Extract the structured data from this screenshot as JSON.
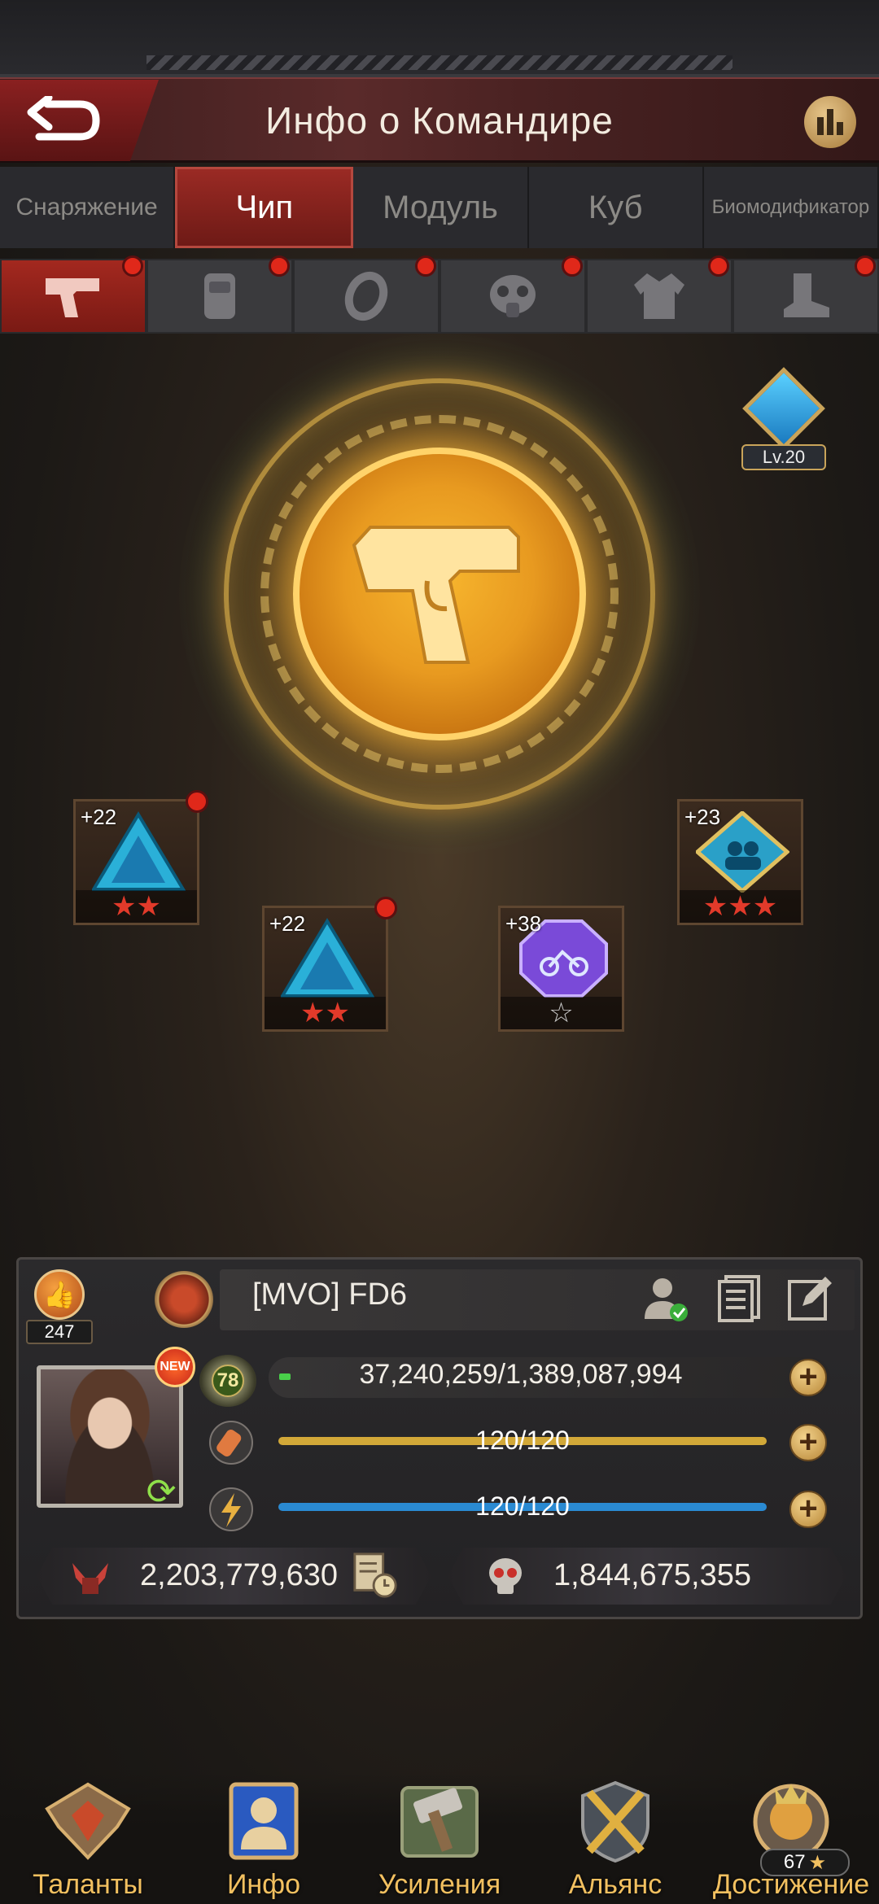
{
  "header": {
    "title": "Инфо о Командире"
  },
  "tabs": [
    {
      "label": "Снаряжение",
      "active": false
    },
    {
      "label": "Чип",
      "active": true
    },
    {
      "label": "Модуль",
      "active": false
    },
    {
      "label": "Куб",
      "active": false
    },
    {
      "label": "Биомодификатор",
      "active": false
    }
  ],
  "slots": [
    {
      "icon": "pistol-icon",
      "active": true,
      "alert": true
    },
    {
      "icon": "vest-icon",
      "active": false,
      "alert": true
    },
    {
      "icon": "ring-icon",
      "active": false,
      "alert": true
    },
    {
      "icon": "gas-mask-icon",
      "active": false,
      "alert": true
    },
    {
      "icon": "jacket-icon",
      "active": false,
      "alert": true
    },
    {
      "icon": "boot-icon",
      "active": false,
      "alert": true
    }
  ],
  "emblem": {
    "icon": "pistol-icon",
    "level_badge": "Lv.20"
  },
  "chips": [
    {
      "level": "+22",
      "stars": 2,
      "star_color": "red",
      "shape": "triangle",
      "alert": true
    },
    {
      "level": "+22",
      "stars": 2,
      "star_color": "red",
      "shape": "triangle",
      "alert": true
    },
    {
      "level": "+38",
      "stars": 1,
      "star_color": "white",
      "shape": "octagon",
      "alert": false
    },
    {
      "level": "+23",
      "stars": 3,
      "star_color": "red",
      "shape": "diamond",
      "alert": false
    }
  ],
  "commander": {
    "likes": "247",
    "name": "[MVO]  FD6",
    "new_badge": "NEW",
    "level": "78",
    "exp_text": "37,240,259/1,389,087,994",
    "exp_fraction": 0.027,
    "stamina_text": "120/120",
    "stamina_fraction": 1.0,
    "energy_text": "120/120",
    "energy_fraction": 1.0,
    "power": "2,203,779,630",
    "kills": "1,844,675,355"
  },
  "colors": {
    "accent_red": "#a3281f",
    "stamina_bar": "#d2a838",
    "energy_bar": "#2a8ad2",
    "nav_label": "#f2c060"
  },
  "nav": [
    {
      "label": "Таланты",
      "icon": "wings-emblem-icon"
    },
    {
      "label": "Инфо",
      "icon": "commander-info-icon"
    },
    {
      "label": "Усиления",
      "icon": "hammer-icon"
    },
    {
      "label": "Альянс",
      "icon": "crossed-swords-icon"
    },
    {
      "label": "Достижение",
      "icon": "lion-trophy-icon",
      "badge": "67"
    }
  ]
}
